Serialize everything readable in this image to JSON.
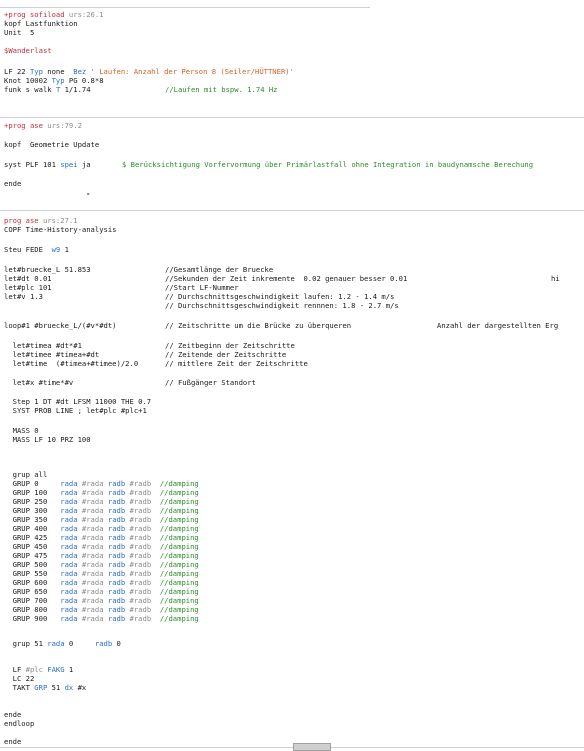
{
  "block1": {
    "l1_cmd": "+prog sofiload",
    "l1_ver": "urs:26.1",
    "l2": "kopf Lastfunktion",
    "l3": "Unit  5",
    "l4": "$Wanderlast",
    "l5_a": "LF 22 ",
    "l5_b": "Typ",
    "l5_c": " none  ",
    "l5_d": "Bez",
    "l5_e": " ' Laufen: Anzahl der Person 8 (Seiler/HÜTTNER)'",
    "l6_a": "Knot 10002 ",
    "l6_b": "Typ",
    "l6_c": " PG 0.8*8",
    "l7_a": "funk s walk ",
    "l7_b": "T",
    "l7_c": " 1/1.74",
    "l7_comment": "//Laufen mit bspw. 1.74 Hz"
  },
  "block2": {
    "l1_cmd": "+prog ase",
    "l1_ver": "urs:79.2",
    "l2": "kopf  Geometrie Update",
    "l3_a": "syst PLF 101 ",
    "l3_b": "spei",
    "l3_c": " ja",
    "l3_comment": "$ Berücksichtigung Vorfervormung über Primärlastfall ohne Integration in baudynamsche Berechung",
    "l4": "ende",
    "l5": "-"
  },
  "block3": {
    "l1_cmd": "prog ase",
    "l1_ver": "urs:27.1",
    "l2": "COPF Time-History-analysis",
    "l3_a": "Steu FEDE  ",
    "l3_b": "w9",
    "l3_c": " 1",
    "let1_a": "let#bruecke_L 51.853",
    "let1_c": "//Gesamtlänge der Bruecke",
    "let2_a": "let#dt 0.01",
    "let2_c": "//Sekunden der Zeit inkremente  0.02 genauer besser 0.01",
    "let2_d": "hi",
    "let3_a": "let#plc 101",
    "let3_c": "//Start LF-Nummer",
    "let4_a": "let#v 1.3",
    "let4_c": "// Durchschnittsgeschwindigkeit laufen: 1.2 - 1.4 m/s",
    "let5_c": "// Durchschnittsgeschwindigkeit rennnen: 1.8 - 2.7 m/s",
    "loop_a": "loop#1 #bruecke_L/(#v*#dt)",
    "loop_c": "// Zeitschritte um die Brücke zu überqueren",
    "loop_d": "Anzahl der dargestellten Erg",
    "t1_a": "  let#timea #dt*#1",
    "t1_c": "// Zeitbeginn der Zeitschritte",
    "t2_a": "  let#timee #timea+#dt",
    "t2_c": "// Zeitende der Zeitschritte",
    "t3_a": "  let#time  (#timea+#timee)/2.0",
    "t3_c": "// mittlere Zeit der Zeitschritte",
    "x_a": "  let#x #time*#v",
    "x_c": "// Fußgänger Standort",
    "step": "  Step 1 DT #dt LFSM 11000 THE 0.7",
    "syst": "  SYST PROB LINE ; let#plc #plc+1",
    "mass1": "  MASS 0",
    "mass2": "  MASS LF 10 PRZ 100",
    "grupall": "  grup all",
    "grup_rows": [
      {
        "n": "0  "
      },
      {
        "n": "100"
      },
      {
        "n": "250"
      },
      {
        "n": "300"
      },
      {
        "n": "350"
      },
      {
        "n": "400"
      },
      {
        "n": "425"
      },
      {
        "n": "450"
      },
      {
        "n": "475"
      },
      {
        "n": "500"
      },
      {
        "n": "550"
      },
      {
        "n": "600"
      },
      {
        "n": "650"
      },
      {
        "n": "700"
      },
      {
        "n": "800"
      },
      {
        "n": "900"
      }
    ],
    "grup_kw": "GRUP",
    "grup_rada": "rada",
    "grup_var_a": "#rada",
    "grup_radb": "radb",
    "grup_var_b": "#radb",
    "grup_comment": "//damping",
    "grup51_a": "  grup 51 ",
    "grup51_b": "rada",
    "grup51_c": " 0     ",
    "grup51_d": "radb",
    "grup51_e": " 0",
    "lf_a": "  LF ",
    "lf_b": "#plc",
    "lf_c": " FAKG",
    "lf_d": " 1",
    "lc": "  LC 22",
    "takt_a": "  TAKT ",
    "takt_b": "GRP",
    "takt_c": " 51 ",
    "takt_d": "dx",
    "takt_e": " #x",
    "ende1": "ende",
    "endloop": "endloop",
    "ende2": "ende"
  }
}
